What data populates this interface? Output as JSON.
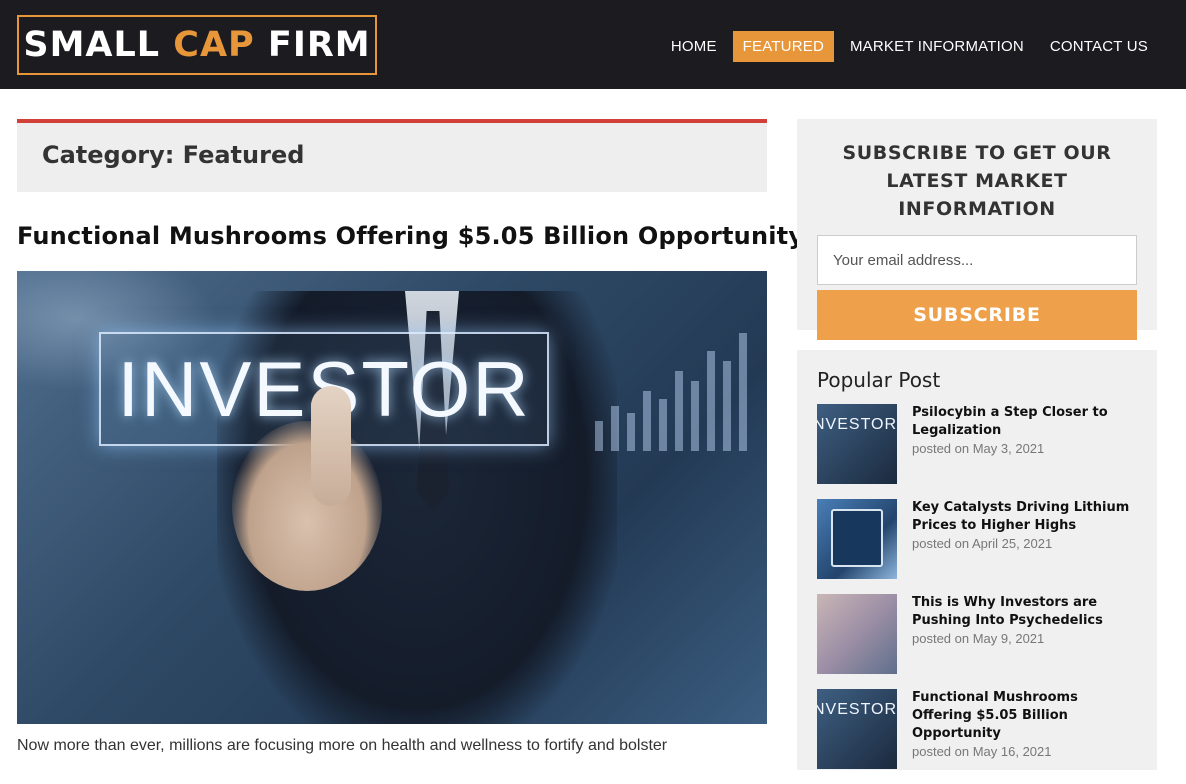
{
  "header": {
    "logo": {
      "part1": "SMALL ",
      "part2": "CAP",
      "part3": " FIRM"
    },
    "nav": [
      "HOME",
      "FEATURED",
      "MARKET INFORMATION",
      "CONTACT US"
    ],
    "active_nav": "FEATURED",
    "accent_color": "#e8963a"
  },
  "main": {
    "category_title": "Category: Featured",
    "post_title": "Functional Mushrooms Offering $5.05 Billion Opportunity",
    "hero_image_text": "INVESTOR",
    "excerpt": "Now more than ever, millions are focusing more on health and wellness to fortify and bolster"
  },
  "sidebar": {
    "subscribe": {
      "heading": "SUBSCRIBE TO GET OUR LATEST MARKET INFORMATION",
      "email_placeholder": "Your email address...",
      "button_label": "SUBSCRIBE"
    },
    "popular": {
      "heading": "Popular Post",
      "posts": [
        {
          "title": "Psilocybin a Step Closer to Legalization",
          "date": "posted on May 3, 2021",
          "thumb_text": "NVESTOR"
        },
        {
          "title": "Key Catalysts Driving Lithium Prices to Higher Highs",
          "date": "posted on April 25, 2021",
          "thumb_text": ""
        },
        {
          "title": "This is Why Investors are Pushing Into Psychedelics",
          "date": "posted on May 9, 2021",
          "thumb_text": ""
        },
        {
          "title": "Functional Mushrooms Offering $5.05 Billion Opportunity",
          "date": "posted on May 16, 2021",
          "thumb_text": "NVESTOR"
        }
      ]
    }
  }
}
